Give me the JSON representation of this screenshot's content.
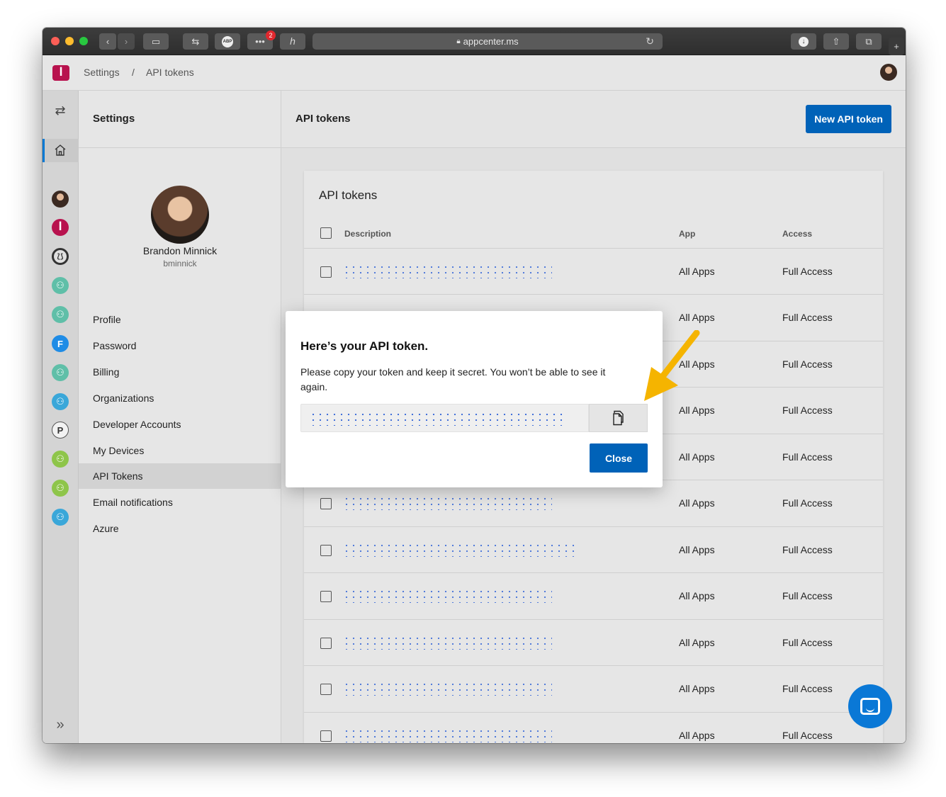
{
  "browser": {
    "url": "appcenter.ms",
    "notification_count": "2",
    "adblock_label": "ABP"
  },
  "header": {
    "breadcrumb": [
      "Settings",
      "API tokens"
    ],
    "breadcrumb_separator": "/"
  },
  "rail": {
    "icons": [
      "swap-icon",
      "home-icon",
      "user-avatar",
      "app-center-icon",
      "xamarin-app-icon",
      "group-icon",
      "group-icon",
      "f-app-icon",
      "group-icon",
      "group-icon",
      "p-app-icon",
      "group-icon",
      "group-icon",
      "group-icon",
      "expand-icon"
    ],
    "f_letter": "F",
    "p_letter": "P",
    "colors": {
      "group_teal": "#5fbfa8",
      "group_blue": "#3aa7d9",
      "group_green": "#8ec54a",
      "brand": "#b8124e",
      "f_blue": "#1f8ce6"
    }
  },
  "settings": {
    "title": "Settings",
    "user_name": "Brandon Minnick",
    "user_handle": "bminnick",
    "nav": [
      {
        "label": "Profile"
      },
      {
        "label": "Password"
      },
      {
        "label": "Billing"
      },
      {
        "label": "Organizations"
      },
      {
        "label": "Developer Accounts"
      },
      {
        "label": "My Devices"
      },
      {
        "label": "API Tokens",
        "active": true
      },
      {
        "label": "Email notifications"
      },
      {
        "label": "Azure"
      }
    ]
  },
  "main": {
    "title": "API tokens",
    "new_token_button": "New API token",
    "card_title": "API tokens",
    "columns": {
      "description": "Description",
      "app": "App",
      "access": "Access"
    },
    "rows": [
      {
        "app": "All Apps",
        "access": "Full Access"
      },
      {
        "app": "All Apps",
        "access": "Full Access"
      },
      {
        "app": "All Apps",
        "access": "Full Access"
      },
      {
        "app": "All Apps",
        "access": "Full Access"
      },
      {
        "app": "All Apps",
        "access": "Full Access"
      },
      {
        "app": "All Apps",
        "access": "Full Access"
      },
      {
        "app": "All Apps",
        "access": "Full Access"
      },
      {
        "app": "All Apps",
        "access": "Full Access"
      },
      {
        "app": "All Apps",
        "access": "Full Access"
      },
      {
        "app": "All Apps",
        "access": "Full Access"
      },
      {
        "app": "All Apps",
        "access": "Full Access"
      }
    ]
  },
  "modal": {
    "title": "Here’s your API token.",
    "message": "Please copy your token and keep it secret. You won’t be able to see it again.",
    "copy_icon": "copy-icon",
    "close_button": "Close"
  },
  "colors": {
    "primary": "#0062b8",
    "arrow": "#f5b400",
    "chat": "#0a78d6"
  }
}
